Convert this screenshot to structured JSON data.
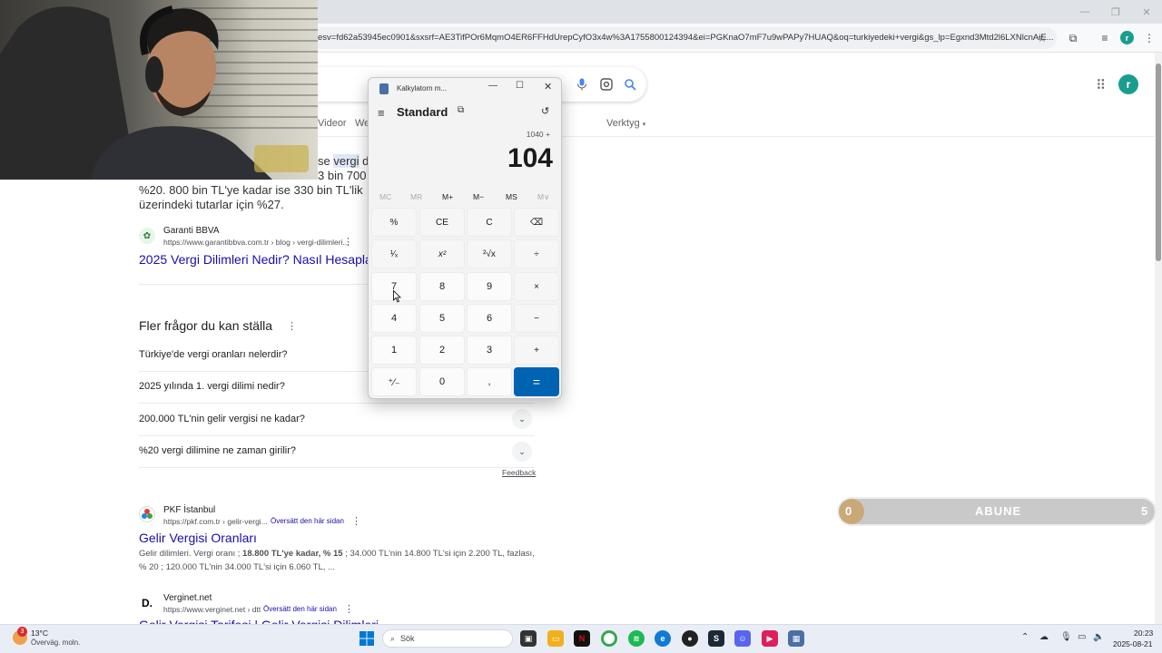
{
  "browser": {
    "url": "esv=fd62a53945ec0901&sxsrf=AE3TifPOr6MqmO4ER6FFHdUrepCyfO3x4w%3A1755800124394&ei=PGKnaO7mF7u9wPAPy7HUAQ&oq=turkiyedeki+vergi&gs_lp=Egxnd3Mtd2l6LXNlcnAiE...",
    "profile_initial": "r"
  },
  "google": {
    "tabs": {
      "videor": "Videor",
      "we": "We",
      "verktyg": "Verktyg"
    },
    "snippet_lines": [
      "se vergi d",
      "3 bin 700",
      "%20. 800 bin TL'ye kadar ise 330 bin TL'lik",
      "üzerindeki tutarlar için %27."
    ],
    "snippet_highlight": "vergi",
    "results": [
      {
        "site": "Garanti BBVA",
        "url": "https://www.garantibbva.com.tr › blog › vergi-dilimleri...",
        "title": "2025 Vergi Dilimleri Nedir? Nasıl Hesaplan"
      },
      {
        "site": "PKF İstanbul",
        "url": "https://pkf.com.tr › gelir-vergi...",
        "cached": "Översätt den här sidan",
        "title": "Gelir Vergisi Oranları",
        "desc_line1_pre": "Gelir dilimleri. Vergi oranı ; ",
        "desc_line1_bold": "18.800 TL'ye kadar, % 15",
        "desc_line1_post": " ; 34.000 TL'nin 14.800 TL'si için 2.200 TL, fazlası,",
        "desc_line2": "% 20 ; 120.000 TL'nin 34.000 TL'si için 6.060 TL, ..."
      },
      {
        "site": "Verginet.net",
        "url": "https://www.verginet.net › dtt",
        "cached": "Översätt den här sidan",
        "title": "Gelir Vergisi Tarifesi | Gelir Vergisi Dilimleri"
      }
    ],
    "paa_heading": "Fler frågor du kan ställa",
    "paa": [
      "Türkiye'de vergi oranları nelerdir?",
      "2025 yılında 1. vergi dilimi nedir?",
      "200.000 TL'nin gelir vergisi ne kadar?",
      "%20 vergi dilimine ne zaman girilir?"
    ],
    "feedback": "Feedback"
  },
  "calculator": {
    "title": "Kalkylatorn m...",
    "mode": "Standard",
    "expression": "1040 +",
    "display": "104",
    "memory": [
      "MC",
      "MR",
      "M+",
      "M−",
      "MS",
      "M∨"
    ],
    "keys": [
      [
        "%",
        "CE",
        "C",
        "⌫"
      ],
      [
        "¹⁄ₓ",
        "x²",
        "²√x",
        "÷"
      ],
      [
        "7",
        "8",
        "9",
        "×"
      ],
      [
        "4",
        "5",
        "6",
        "−"
      ],
      [
        "1",
        "2",
        "3",
        "+"
      ],
      [
        "⁺⁄₋",
        "0",
        ",",
        "="
      ]
    ]
  },
  "subscribe": {
    "left": "0",
    "label": "ABUNE",
    "right": "5",
    "progress": 0
  },
  "taskbar": {
    "weather_temp": "13°C",
    "weather_desc": "Överväg. moln.",
    "weather_badge": "3",
    "search": "Sök",
    "time": "20:23",
    "date": "2025-08-21"
  },
  "colors": {
    "accent": "#0063b1",
    "link": "#1a0dab",
    "avatar": "#1a9d8f"
  }
}
